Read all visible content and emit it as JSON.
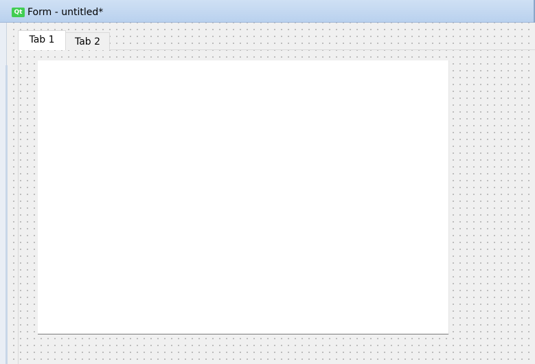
{
  "window": {
    "logo_text": "Qt",
    "title": "Form - untitled*",
    "accent_color": "#41cd52",
    "titlebar_color": "#c4d8f0"
  },
  "tabs": [
    {
      "label": "Tab 1",
      "selected": true
    },
    {
      "label": "Tab 2",
      "selected": false
    }
  ],
  "canvas": {
    "background": "#f0f0f0",
    "grid": "dotted"
  }
}
